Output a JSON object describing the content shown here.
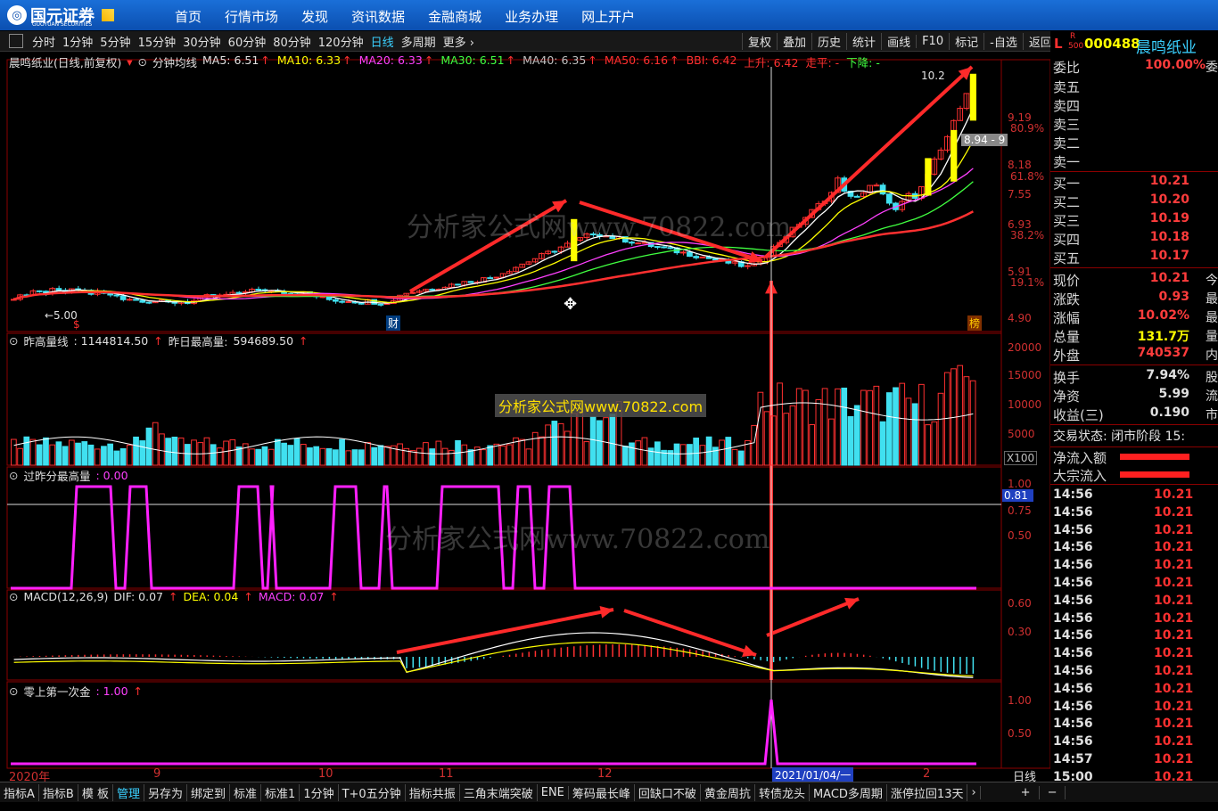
{
  "topbar": {
    "brand": "国元证券",
    "brand_sub": "GUOYUAN SECURITIES",
    "nav": [
      "首页",
      "行情市场",
      "发现",
      "资讯数据",
      "金融商城",
      "业务办理",
      "网上开户"
    ]
  },
  "periods": [
    "分时",
    "1分钟",
    "5分钟",
    "15分钟",
    "30分钟",
    "60分钟",
    "80分钟",
    "120分钟",
    "日线",
    "多周期",
    "更多 ›"
  ],
  "selected_period": "日线",
  "tools": [
    "复权",
    "叠加",
    "历史",
    "统计",
    "画线",
    "F10",
    "标记",
    "-自选",
    "返回"
  ],
  "stock": {
    "flag": "L",
    "r": "R",
    "r500": "500",
    "code": "000488",
    "name": "晨鸣纸业"
  },
  "main_panel": {
    "title": "晨鸣纸业(日线,前复权)",
    "indicator": "分钟均线",
    "ma": [
      {
        "label": "MA5: 6.51",
        "color": "#e0e0e0"
      },
      {
        "label": "MA10: 6.33",
        "color": "#ffff00"
      },
      {
        "label": "MA20: 6.33",
        "color": "#ff40ff"
      },
      {
        "label": "MA30: 6.51",
        "color": "#40ff40"
      },
      {
        "label": "MA40: 6.35",
        "color": "#c0c0c0"
      },
      {
        "label": "MA50: 6.16",
        "color": "#ff3030"
      },
      {
        "label": "BBI: 6.42",
        "color": "#ff3030"
      },
      {
        "label": "上升: 6.42",
        "color": "#ff3030"
      },
      {
        "label": "走平: -",
        "color": "#ff3030"
      },
      {
        "label": "下降: -",
        "color": "#40ff40"
      }
    ],
    "yaxis": [
      "9.19",
      "80.9%",
      "8.18",
      "61.8%",
      "7.55",
      "6.93",
      "38.2%",
      "5.91",
      "19.1%",
      "4.90"
    ],
    "low_label": "←5.00",
    "high_label": "10.2",
    "price_tag": "8.94 - 9",
    "marks": [
      "财",
      "榜",
      "$"
    ]
  },
  "vol_panel": {
    "title": "昨高量线",
    "value": ": 1144814.50",
    "label2": "昨日最高量:",
    "value2": "594689.50",
    "yaxis": [
      "20000",
      "15000",
      "10000",
      "5000"
    ],
    "unit": "X100"
  },
  "p3_panel": {
    "title": "过昨分最高量",
    "value": ": 0.00",
    "yaxis": [
      "1.00",
      "0.81",
      "0.75",
      "0.50"
    ]
  },
  "macd_panel": {
    "title": "MACD(12,26,9)",
    "dif": "DIF: 0.07",
    "dea": "DEA: 0.04",
    "macd": "MACD: 0.07",
    "yaxis": [
      "0.60",
      "0.30"
    ]
  },
  "p5_panel": {
    "title": "零上第一次金",
    "value": ": 1.00",
    "yaxis": [
      "1.00",
      "0.50"
    ]
  },
  "xaxis": {
    "labels": [
      "2020年",
      "9",
      "10",
      "11",
      "12",
      "2",
      "日线"
    ],
    "cursor_date": "2021/01/04/一"
  },
  "watermark": "分析家公式网www.70822.com",
  "right_panel": {
    "webi": {
      "k": "委比",
      "v": "100.00%",
      "e": "委"
    },
    "sell": [
      "卖五",
      "卖四",
      "卖三",
      "卖二",
      "卖一"
    ],
    "buy": [
      {
        "k": "买一",
        "v": "10.21"
      },
      {
        "k": "买二",
        "v": "10.20"
      },
      {
        "k": "买三",
        "v": "10.19"
      },
      {
        "k": "买四",
        "v": "10.18"
      },
      {
        "k": "买五",
        "v": "10.17"
      }
    ],
    "stats": [
      {
        "k": "现价",
        "v": "10.21",
        "e": "今"
      },
      {
        "k": "涨跌",
        "v": "0.93",
        "e": "最"
      },
      {
        "k": "涨幅",
        "v": "10.02%",
        "e": "最"
      },
      {
        "k": "总量",
        "v": "131.7万",
        "e": "量"
      },
      {
        "k": "外盘",
        "v": "740537",
        "e": "内"
      }
    ],
    "stats2": [
      {
        "k": "换手",
        "v": "7.94%",
        "e": "股"
      },
      {
        "k": "净资",
        "v": "5.99",
        "e": "流"
      },
      {
        "k": "收益(三)",
        "v": "0.190",
        "e": "市"
      }
    ],
    "status": "交易状态: 闭市阶段 15:",
    "flow": [
      "净流入额",
      "大宗流入"
    ],
    "ticks": [
      {
        "t": "14:56",
        "p": "10.21"
      },
      {
        "t": "14:56",
        "p": "10.21"
      },
      {
        "t": "14:56",
        "p": "10.21"
      },
      {
        "t": "14:56",
        "p": "10.21"
      },
      {
        "t": "14:56",
        "p": "10.21"
      },
      {
        "t": "14:56",
        "p": "10.21"
      },
      {
        "t": "14:56",
        "p": "10.21"
      },
      {
        "t": "14:56",
        "p": "10.21"
      },
      {
        "t": "14:56",
        "p": "10.21"
      },
      {
        "t": "14:56",
        "p": "10.21"
      },
      {
        "t": "14:56",
        "p": "10.21"
      },
      {
        "t": "14:56",
        "p": "10.21"
      },
      {
        "t": "14:56",
        "p": "10.21"
      },
      {
        "t": "14:56",
        "p": "10.21"
      },
      {
        "t": "14:56",
        "p": "10.21"
      },
      {
        "t": "14:57",
        "p": "10.21"
      },
      {
        "t": "15:00",
        "p": "10.21"
      }
    ]
  },
  "bottom_tabs": [
    "指标A",
    "指标B",
    "模 板",
    "管理",
    "另存为",
    "绑定到",
    "标准",
    "标准1",
    "1分钟",
    "T+0五分钟",
    "指标共振",
    "三角末端突破",
    "ENE",
    "筹码最长峰",
    "回缺口不破",
    "黄金周抗",
    "转债龙头",
    "MACD多周期",
    "涨停拉回13天",
    "›",
    "+",
    "−"
  ],
  "bottom_selected": "管理",
  "colors": {
    "up": "#ff3030",
    "down": "#40e0f0",
    "pink": "#ff20ff",
    "yellow": "#ffff00"
  }
}
